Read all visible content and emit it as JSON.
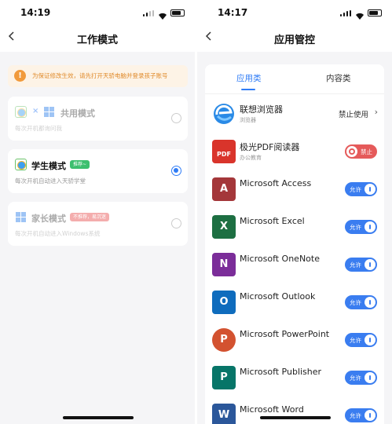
{
  "left": {
    "status": {
      "time": "14:19"
    },
    "title": "工作模式",
    "notice": "为保证修改生效，请先打开天骄电脑并登录孩子账号",
    "modes": [
      {
        "title": "共用模式",
        "sub": "每次开机都询问我",
        "badge": "",
        "selected": false,
        "enabled": false
      },
      {
        "title": "学生模式",
        "sub": "每次开机自动进入天骄学堂",
        "badge": "推荐~",
        "selected": true,
        "enabled": true
      },
      {
        "title": "家长模式",
        "sub": "每次开机自动进入Windows系统",
        "badge": "不推荐，易沉迷",
        "selected": false,
        "enabled": false
      }
    ],
    "mult": "×"
  },
  "right": {
    "status": {
      "time": "14:17"
    },
    "title": "应用管控",
    "tabs": [
      "应用类",
      "内容类"
    ],
    "active_tab": 0,
    "apps": [
      {
        "name": "联想浏览器",
        "category": "浏览器",
        "control": "status",
        "status_text": "禁止使用",
        "icon": "lenovo-browser-icon"
      },
      {
        "name": "极光PDF阅读器",
        "category": "办公教育",
        "control": "toggle",
        "state": "deny",
        "label": "禁止",
        "icon_text": "PDF",
        "icon": "pdf-reader-icon"
      },
      {
        "name": "Microsoft Access",
        "category": "",
        "control": "toggle",
        "state": "allow",
        "label": "允许",
        "icon_text": "A",
        "icon_color": "#a4373a",
        "icon": "access-icon"
      },
      {
        "name": "Microsoft Excel",
        "category": "",
        "control": "toggle",
        "state": "allow",
        "label": "允许",
        "icon_text": "X",
        "icon_color": "#1d6f42",
        "icon": "excel-icon"
      },
      {
        "name": "Microsoft OneNote",
        "category": "",
        "control": "toggle",
        "state": "allow",
        "label": "允许",
        "icon_text": "N",
        "icon_color": "#7b2d99",
        "icon": "onenote-icon"
      },
      {
        "name": "Microsoft Outlook",
        "category": "",
        "control": "toggle",
        "state": "allow",
        "label": "允许",
        "icon_text": "O",
        "icon_color": "#0f6cbd",
        "icon": "outlook-icon"
      },
      {
        "name": "Microsoft PowerPoint",
        "category": "",
        "control": "toggle",
        "state": "allow",
        "label": "允许",
        "icon_text": "P",
        "icon_color": "#d35230",
        "icon": "powerpoint-icon"
      },
      {
        "name": "Microsoft Publisher",
        "category": "",
        "control": "toggle",
        "state": "allow",
        "label": "允许",
        "icon_text": "P",
        "icon_color": "#077568",
        "icon": "publisher-icon"
      },
      {
        "name": "Microsoft Word",
        "category": "",
        "control": "toggle",
        "state": "allow",
        "label": "允许",
        "icon_text": "W",
        "icon_color": "#2b579a",
        "icon": "word-icon"
      }
    ]
  },
  "colors": {
    "accent": "#2f7cf6",
    "allow": "#3a7df0",
    "deny": "#e55a5a",
    "notice": "#e08a2a"
  }
}
